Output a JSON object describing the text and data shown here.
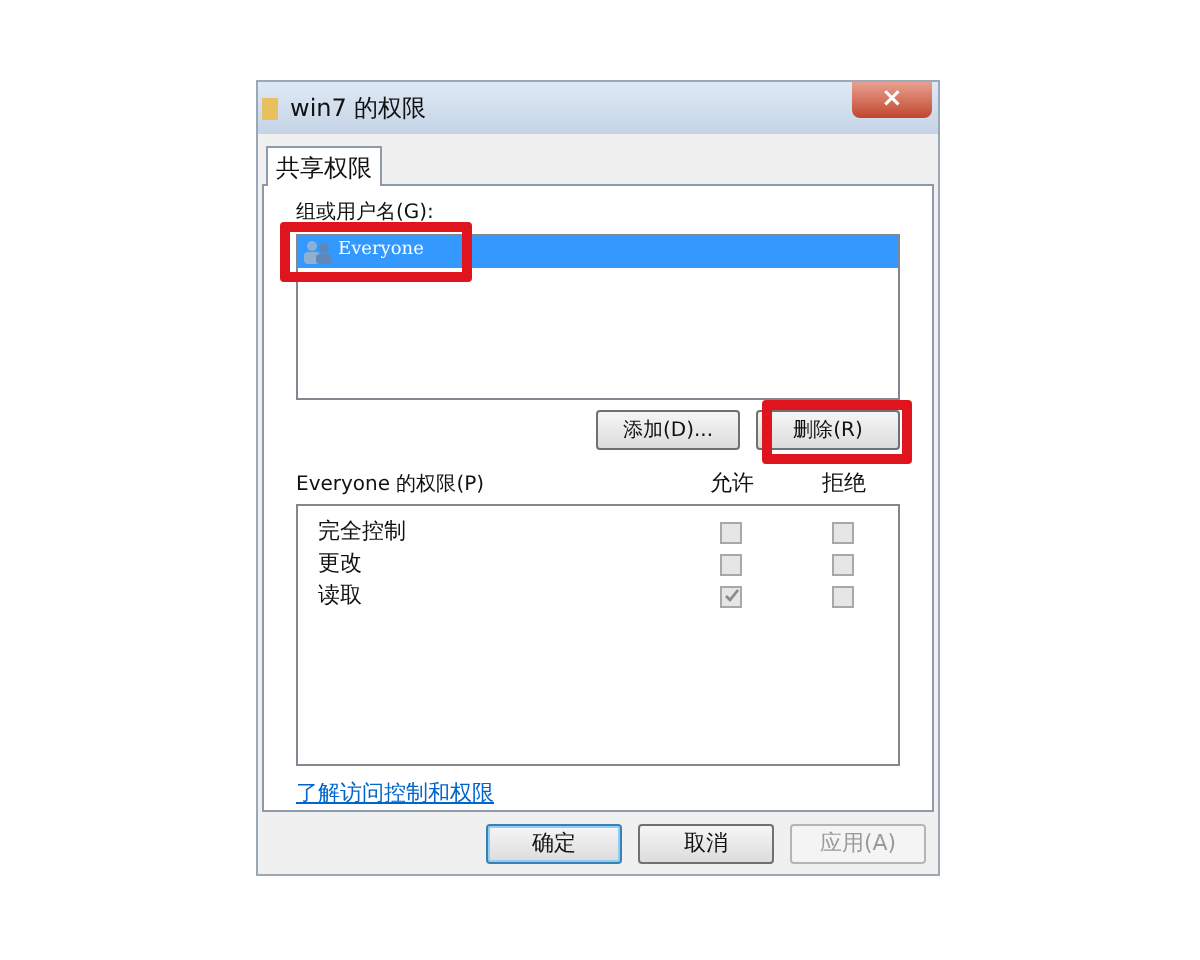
{
  "window": {
    "title": "win7 的权限",
    "close": "×"
  },
  "tabs": [
    {
      "label": "共享权限",
      "selected": true
    }
  ],
  "users": {
    "label": "组或用户名(G):",
    "items": [
      {
        "name": "Everyone",
        "selected": true
      }
    ],
    "buttons": [
      {
        "label": "添加(D)..."
      },
      {
        "label": "删除(R)"
      }
    ]
  },
  "permissions": {
    "label": "Everyone 的权限(P)",
    "columns": [
      "允许",
      "拒绝"
    ],
    "disabled": true,
    "rows": [
      {
        "name": "完全控制",
        "allow": false,
        "deny": false
      },
      {
        "name": "更改",
        "allow": false,
        "deny": false
      },
      {
        "name": "读取",
        "allow": true,
        "deny": false
      }
    ]
  },
  "link": "了解访问控制和权限",
  "buttons": [
    {
      "label": "确定",
      "disabled": false,
      "default": true
    },
    {
      "label": "取消",
      "disabled": false,
      "default": false
    },
    {
      "label": "应用(A)",
      "disabled": true,
      "default": false
    }
  ]
}
